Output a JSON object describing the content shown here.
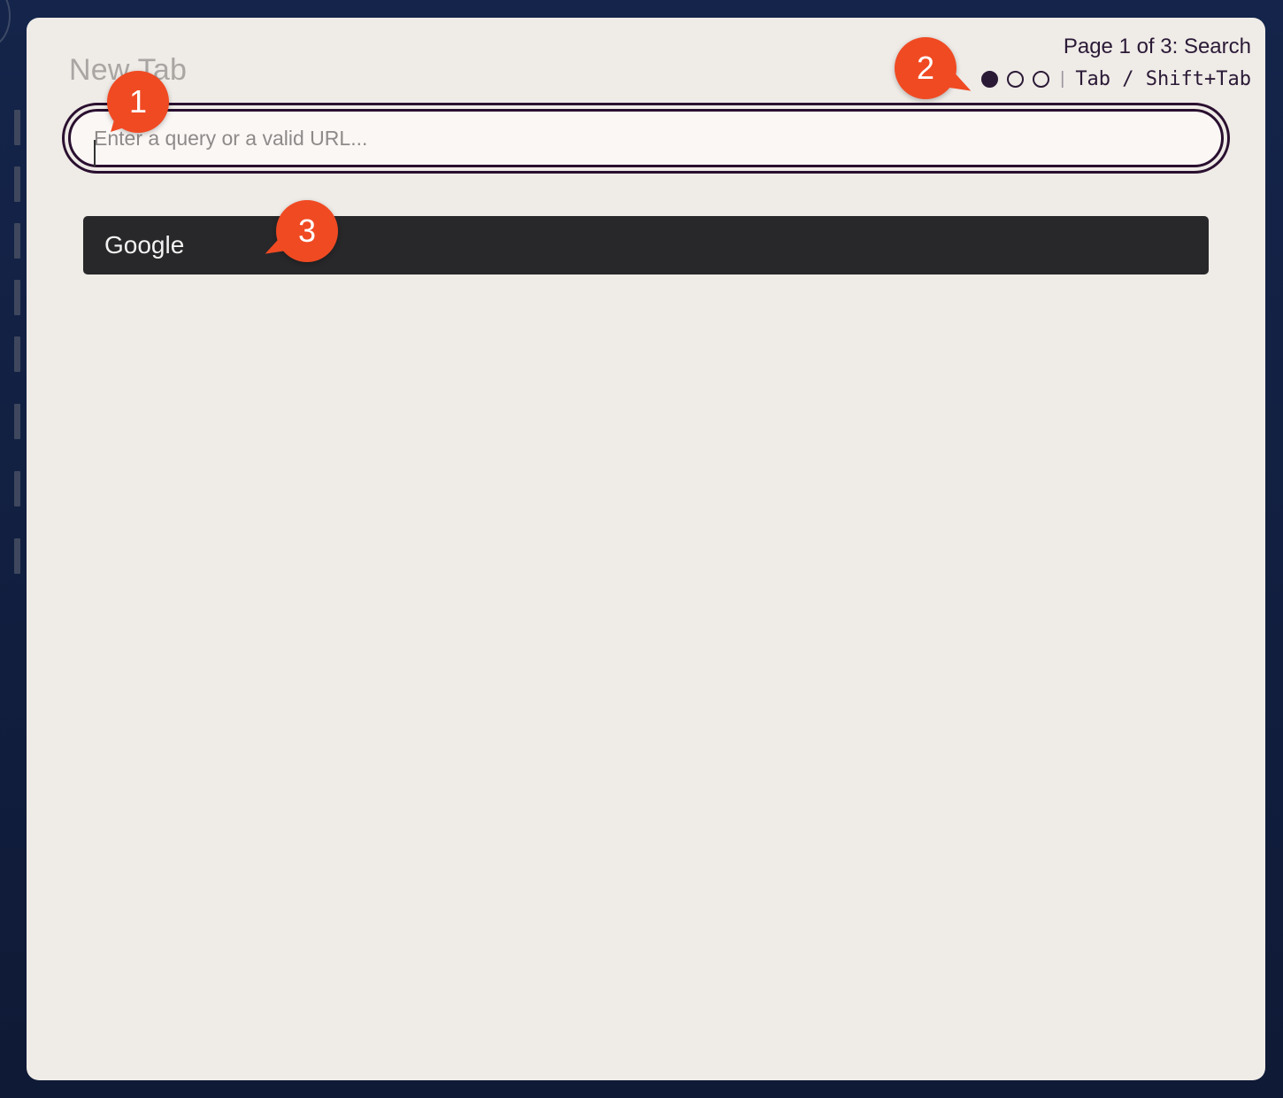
{
  "window": {
    "title": "New Tab"
  },
  "pager": {
    "label": "Page 1 of 3: Search",
    "current_page": 1,
    "total_pages": 3,
    "separator": "|",
    "shortcut_hint": "Tab / Shift+Tab"
  },
  "search": {
    "value": "",
    "placeholder": "Enter a query or a valid URL..."
  },
  "results": [
    {
      "label": "Google"
    }
  ],
  "annotations": [
    {
      "label": "1"
    },
    {
      "label": "2"
    },
    {
      "label": "3"
    }
  ],
  "colors": {
    "panel_background": "#efebe7",
    "accent_dark": "#2a1030",
    "result_background": "#28282a",
    "marker": "#f04a23",
    "page_background": "#13203f"
  }
}
